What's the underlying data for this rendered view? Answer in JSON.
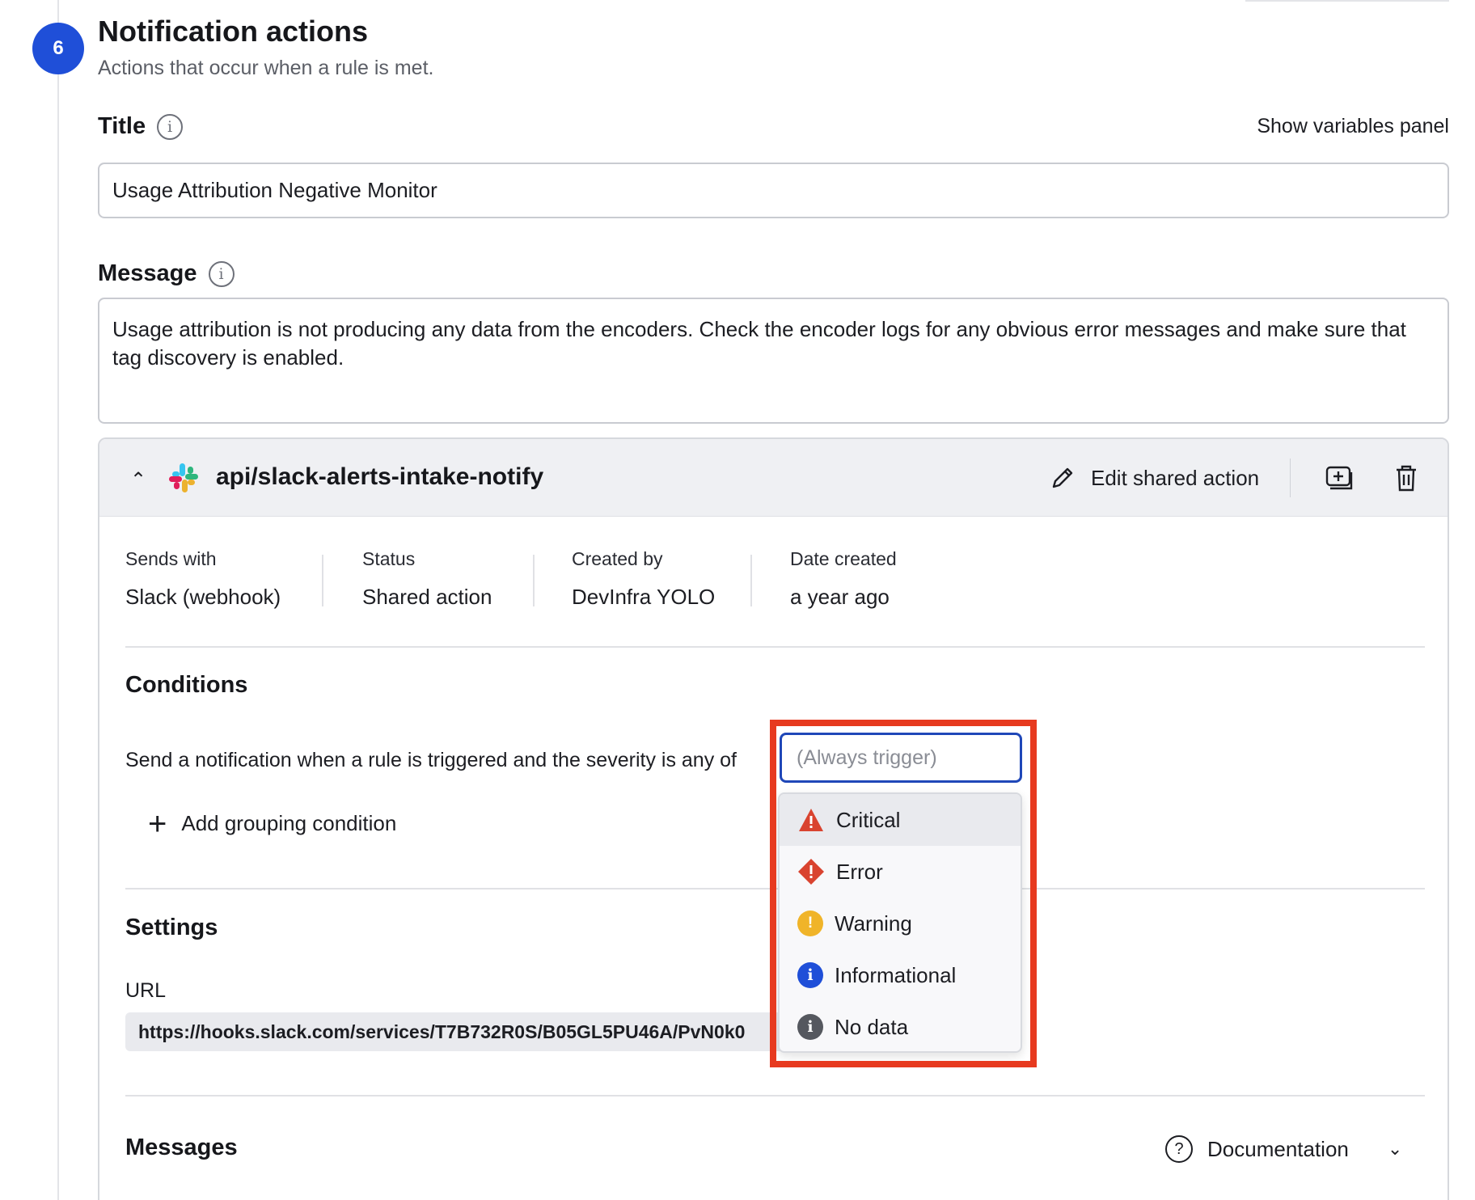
{
  "section": {
    "step_number": "6",
    "title": "Notification actions",
    "subtitle": "Actions that occur when a rule is met."
  },
  "title_field": {
    "label": "Title",
    "value": "Usage Attribution Negative Monitor",
    "variables_link": "Show variables panel"
  },
  "message_field": {
    "label": "Message",
    "value": "Usage attribution is not producing any data from the encoders. Check the encoder logs for any obvious error messages and make sure that tag discovery is enabled."
  },
  "action_card": {
    "name": "api/slack-alerts-intake-notify",
    "edit_label": "Edit shared action",
    "meta": [
      {
        "key": "Sends with",
        "value": "Slack (webhook)"
      },
      {
        "key": "Status",
        "value": "Shared action"
      },
      {
        "key": "Created by",
        "value": "DevInfra YOLO"
      },
      {
        "key": "Date created",
        "value": "a year ago"
      }
    ],
    "conditions": {
      "heading": "Conditions",
      "sentence": "Send a notification when a rule is triggered and the severity is any of",
      "severity_placeholder": "(Always trigger)",
      "add_grouping": "Add grouping condition"
    },
    "severity_options": [
      {
        "label": "Critical",
        "color": "#d9432f",
        "icon": "critical-triangle-icon"
      },
      {
        "label": "Error",
        "color": "#d9432f",
        "icon": "error-diamond-icon"
      },
      {
        "label": "Warning",
        "color": "#f0b429",
        "icon": "warning-circle-icon"
      },
      {
        "label": "Informational",
        "color": "#1f4fd8",
        "icon": "info-circle-icon"
      },
      {
        "label": "No data",
        "color": "#55585f",
        "icon": "no-data-circle-icon"
      }
    ],
    "settings": {
      "heading": "Settings",
      "url_label": "URL",
      "url_value": "https://hooks.slack.com/services/T7B732R0S/B05GL5PU46A/PvN0k0"
    },
    "messages": {
      "heading": "Messages",
      "docs_label": "Documentation"
    }
  },
  "colors": {
    "accent": "#1f4fd8",
    "highlight": "#e73a1f"
  }
}
